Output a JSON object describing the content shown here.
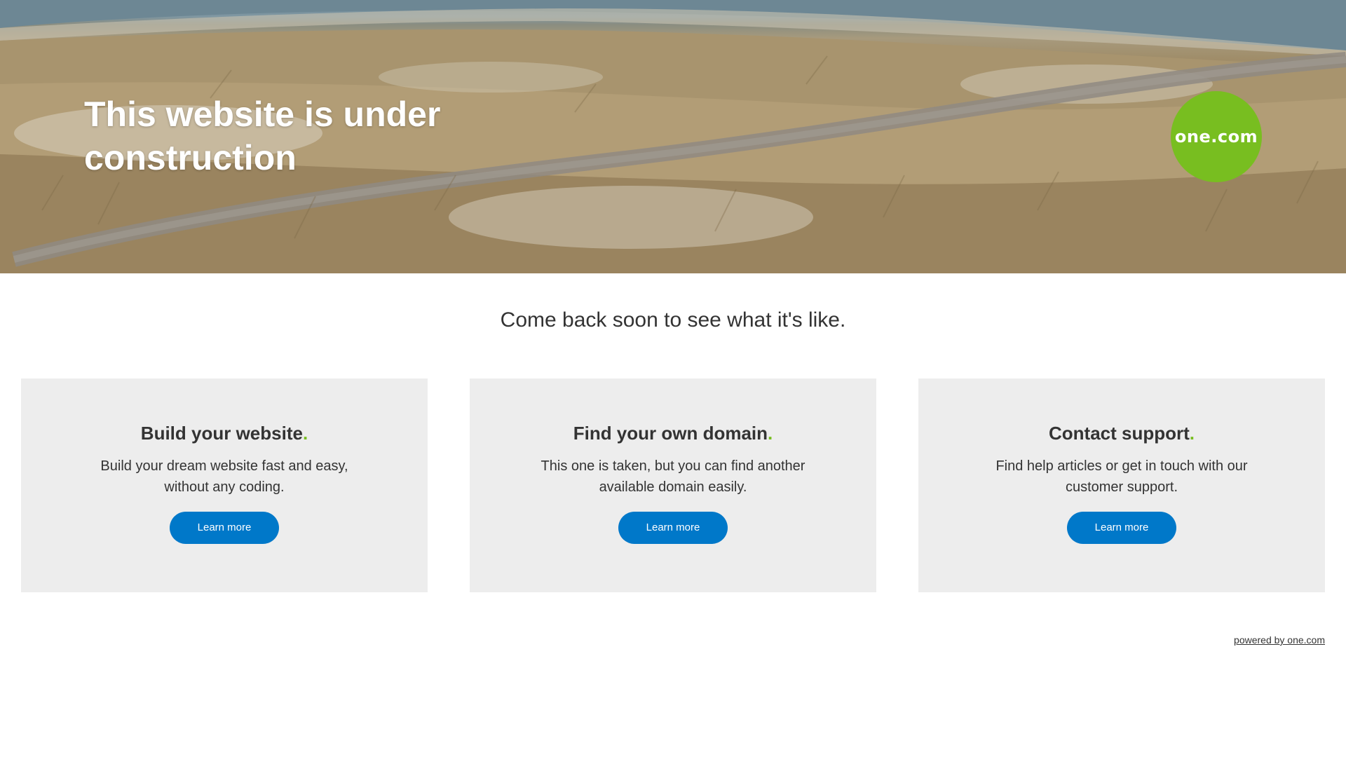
{
  "hero": {
    "title": "This website is under construction",
    "logo_text": "one.com",
    "logo_color": "#78be20"
  },
  "tagline": "Come back soon to see what it's like.",
  "cards": [
    {
      "heading": "Build your website",
      "dot": ".",
      "text": "Build your dream website fast and easy, without any coding.",
      "button": "Learn more"
    },
    {
      "heading": "Find your own domain",
      "dot": ".",
      "text": "This one is taken, but you can find another available domain easily.",
      "button": "Learn more"
    },
    {
      "heading": "Contact support",
      "dot": ".",
      "text": "Find help articles or get in touch with our customer support.",
      "button": "Learn more"
    }
  ],
  "footer": {
    "powered_by": "powered by one.com"
  },
  "colors": {
    "accent_green": "#78be20",
    "button_blue": "#0078c9",
    "card_background": "#ededed",
    "text": "#333333"
  }
}
